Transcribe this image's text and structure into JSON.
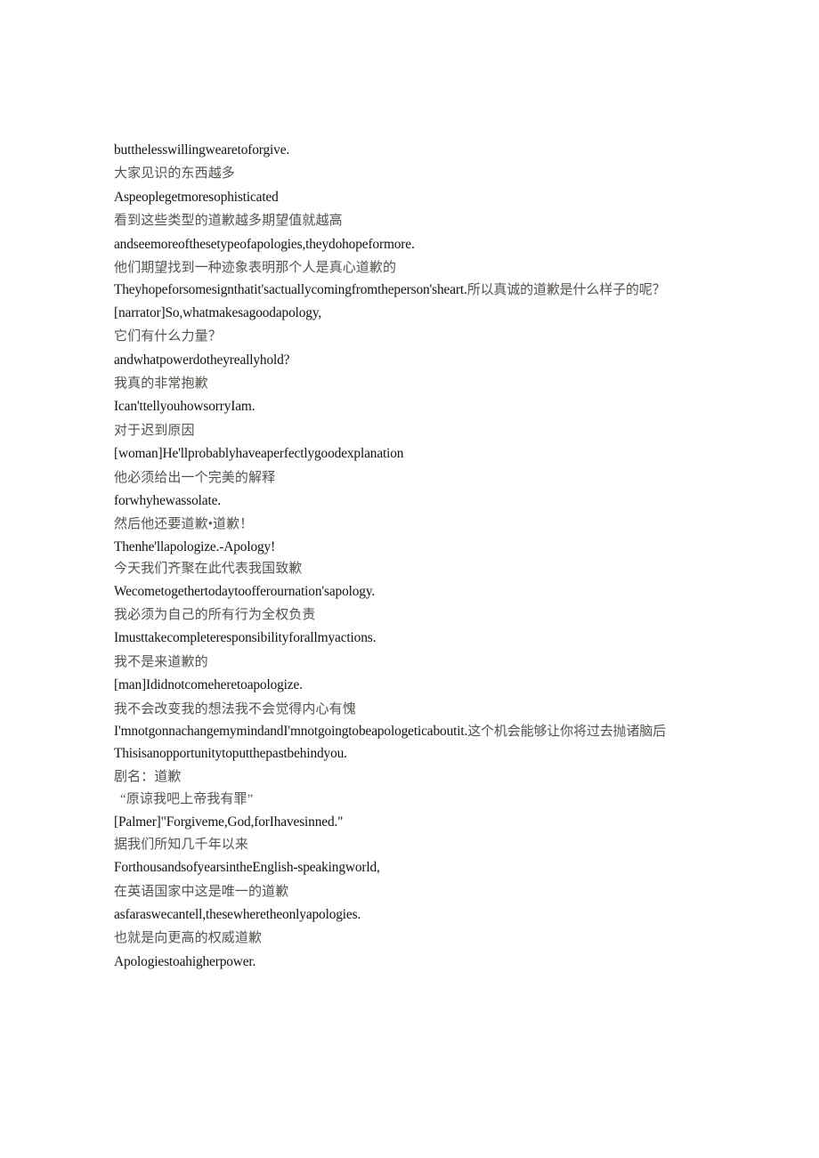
{
  "document": {
    "background_color": "#ffffff",
    "text_color_latin": "#15120f",
    "text_color_cjk": "#56524e",
    "lines": [
      {
        "id": 1,
        "lang": "en",
        "text": "butthelesswillingwearetoforgive."
      },
      {
        "id": 2,
        "lang": "zh",
        "text": "大家见识的东西越多"
      },
      {
        "id": 3,
        "lang": "en",
        "text": "Aspeoplegetmoresophisticated"
      },
      {
        "id": 4,
        "lang": "zh",
        "text": "看到这些类型的道歉越多期望值就越高"
      },
      {
        "id": 5,
        "lang": "en",
        "text": "andseemoreofthesetypeofapologies,theydohopeformore."
      },
      {
        "id": 6,
        "lang": "zh",
        "text": "他们期望找到一种迹象表明那个人是真心道歉的"
      },
      {
        "id": 7,
        "lang": "mixed",
        "latin": "Theyhopeforsomesignthatit'sactuallycomingfromtheperson'sheart.",
        "cjk": "所以真诚的道歉是什么样子的呢？"
      },
      {
        "id": 8,
        "lang": "en",
        "text": "[narrator]So,whatmakesagoodapology,"
      },
      {
        "id": 9,
        "lang": "zh",
        "text": "它们有什么力量？"
      },
      {
        "id": 10,
        "lang": "en",
        "text": "andwhatpowerdotheyreallyhold?"
      },
      {
        "id": 11,
        "lang": "zh",
        "text": "我真的非常抱歉"
      },
      {
        "id": 12,
        "lang": "en",
        "text": "Ican'ttellyouhowsorryIam."
      },
      {
        "id": 13,
        "lang": "zh",
        "text": "对于迟到原因"
      },
      {
        "id": 14,
        "lang": "en",
        "text": "[woman]He'llprobablyhaveaperfectlygoodexplanation"
      },
      {
        "id": 15,
        "lang": "zh",
        "text": "他必须给出一个完美的解释"
      },
      {
        "id": 16,
        "lang": "en",
        "text": "forwhyhewassolate."
      },
      {
        "id": 17,
        "lang": "zh",
        "text": "然后他还要道歉•道歉！",
        "tight": true
      },
      {
        "id": 18,
        "lang": "en",
        "text": "Thenhe'llapologize.-Apology!",
        "tight": true
      },
      {
        "id": 19,
        "lang": "zh",
        "text": "今天我们齐聚在此代表我国致歉",
        "tight": true
      },
      {
        "id": 20,
        "lang": "en",
        "text": "Wecometogethertodaytoofferournation'sapology."
      },
      {
        "id": 21,
        "lang": "zh",
        "text": "我必须为自己的所有行为全权负责"
      },
      {
        "id": 22,
        "lang": "en",
        "text": "Imusttakecompleteresponsibilityforallmyactions."
      },
      {
        "id": 23,
        "lang": "zh",
        "text": "我不是来道歉的"
      },
      {
        "id": 24,
        "lang": "en",
        "text": "[man]Ididnotcomeheretoapologize."
      },
      {
        "id": 25,
        "lang": "zh",
        "text": "我不会改变我的想法我不会觉得内心有愧"
      },
      {
        "id": 26,
        "lang": "mixed",
        "latin": "I'mnotgonnachangemymindandI'mnotgoingtobeapologeticaboutit.",
        "cjk": "这个机会能够让你将过去抛诸脑后"
      },
      {
        "id": 27,
        "lang": "en",
        "text": "Thisisanopportunitytoputthepastbehindyou."
      },
      {
        "id": 28,
        "lang": "zh",
        "text": "剧名：道歉",
        "tight": true
      },
      {
        "id": 29,
        "lang": "zh",
        "text": "“原谅我吧上帝我有罪”",
        "tight": true,
        "indent": true
      },
      {
        "id": 30,
        "lang": "en",
        "text": "[Palmer]\"Forgiveme,God,forIhavesinned.\"",
        "tight": true
      },
      {
        "id": 31,
        "lang": "zh",
        "text": "据我们所知几千年以来"
      },
      {
        "id": 32,
        "lang": "en",
        "text": "ForthousandsofyearsintheEnglish-speakingworld,"
      },
      {
        "id": 33,
        "lang": "zh",
        "text": "在英语国家中这是唯一的道歉"
      },
      {
        "id": 34,
        "lang": "en",
        "text": "asfaraswecantell,thesewheretheonlyapologies."
      },
      {
        "id": 35,
        "lang": "zh",
        "text": "也就是向更高的权威道歉"
      },
      {
        "id": 36,
        "lang": "en",
        "text": "Apologiestoahigherpower."
      }
    ]
  }
}
